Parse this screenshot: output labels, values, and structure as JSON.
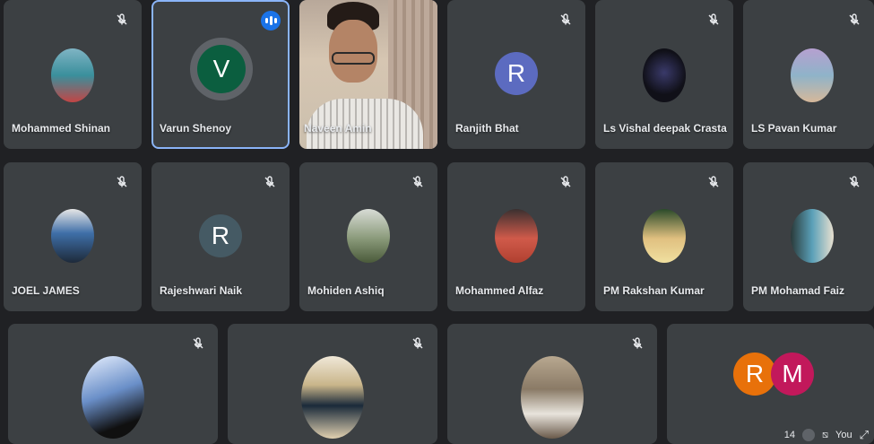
{
  "participants_row1": [
    {
      "name": "Mohammed Shinan",
      "avatar_type": "photo",
      "avatar_color": "#4a90a4",
      "muted": true
    },
    {
      "name": "Varun Shenoy",
      "avatar_type": "letter",
      "avatar_letter": "V",
      "avatar_color": "#0b5e3f",
      "muted": false,
      "speaking": true
    },
    {
      "name": "Naveen Amin",
      "avatar_type": "video",
      "muted": false
    },
    {
      "name": "Ranjith Bhat",
      "avatar_type": "letter",
      "avatar_letter": "R",
      "avatar_color": "#5c6bc0",
      "muted": true
    },
    {
      "name": "Ls Vishal deepak Crasta",
      "avatar_type": "photo",
      "avatar_color": "#101018",
      "muted": true
    },
    {
      "name": "LS Pavan Kumar",
      "avatar_type": "photo",
      "avatar_color": "#8fb3c9",
      "muted": true
    }
  ],
  "participants_row2": [
    {
      "name": "JOEL JAMES",
      "avatar_type": "photo",
      "avatar_color": "#3f6fa8",
      "muted": true
    },
    {
      "name": "Rajeshwari Naik",
      "avatar_type": "letter",
      "avatar_letter": "R",
      "avatar_color": "#455a64",
      "muted": true
    },
    {
      "name": "Mohiden Ashiq",
      "avatar_type": "photo",
      "avatar_color": "#8a9a7a",
      "muted": true
    },
    {
      "name": "Mohammed Alfaz",
      "avatar_type": "photo",
      "avatar_color": "#d05a4a",
      "muted": true
    },
    {
      "name": "PM Rakshan Kumar",
      "avatar_type": "photo",
      "avatar_color": "#e0c080",
      "muted": true
    },
    {
      "name": "PM Mohamad Faiz",
      "avatar_type": "photo",
      "avatar_color": "#5aa0b8",
      "muted": true
    }
  ],
  "participants_row3": [
    {
      "name": "",
      "avatar_type": "photo",
      "avatar_color": "#6a8fc8",
      "muted": true
    },
    {
      "name": "",
      "avatar_type": "photo",
      "avatar_color": "#c9b58a",
      "muted": true
    },
    {
      "name": "",
      "avatar_type": "photo",
      "avatar_color": "#8a7a66",
      "muted": true
    }
  ],
  "overflow_tile": {
    "avatars": [
      {
        "letter": "R",
        "color": "#e8710a"
      },
      {
        "letter": "M",
        "color": "#c2185b"
      }
    ],
    "count": "14",
    "you_label": "You"
  },
  "video_name_partial": "Naveen Amin",
  "colors": {
    "background": "#202124",
    "tile": "#3c4043",
    "active_border": "#8ab4f8",
    "speaking_badge": "#1a73e8"
  },
  "icons": {
    "muted": "mic-off-icon",
    "speaking": "audio-wave-icon",
    "expand": "expand-icon"
  }
}
